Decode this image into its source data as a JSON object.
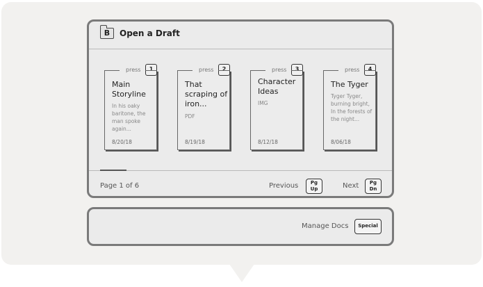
{
  "dialog": {
    "title": "Open a Draft",
    "icon_letter": "B"
  },
  "cards": [
    {
      "press_label": "press",
      "key": "1",
      "title": "Main Storyline",
      "snippet": "In his oaky baritone, the man spoke again...",
      "date": "8/20/18"
    },
    {
      "press_label": "press",
      "key": "2",
      "title": "That scraping of iron...",
      "snippet": "PDF",
      "date": "8/19/18"
    },
    {
      "press_label": "press",
      "key": "3",
      "title": "Character Ideas",
      "snippet": "IMG",
      "date": "8/12/18"
    },
    {
      "press_label": "press",
      "key": "4",
      "title": "The Tyger",
      "snippet": "Tyger Tyger, burning bright, In the forests of the night...",
      "date": "8/06/18"
    }
  ],
  "footer": {
    "page_info": "Page 1 of 6",
    "previous_label": "Previous",
    "previous_key_line1": "Pg",
    "previous_key_line2": "Up",
    "next_label": "Next",
    "next_key_line1": "Pg",
    "next_key_line2": "Dn"
  },
  "manage": {
    "label": "Manage Docs",
    "key": "Special"
  }
}
